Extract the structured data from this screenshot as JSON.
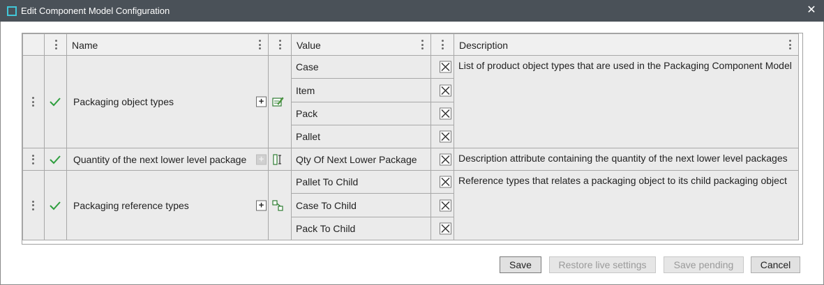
{
  "window": {
    "title": "Edit Component Model Configuration",
    "close_glyph": "✕"
  },
  "columns": {
    "name": "Name",
    "value": "Value",
    "description": "Description"
  },
  "rows": [
    {
      "name": "Packaging object types",
      "status": "check-icon",
      "add_enabled": true,
      "type_icon": "edit-list-icon",
      "values": [
        "Case",
        "Item",
        "Pack",
        "Pallet"
      ],
      "description": "List of product object types that are used in the Packaging Component Model"
    },
    {
      "name": "Quantity of the next lower level package",
      "status": "check-icon",
      "add_enabled": false,
      "type_icon": "attribute-icon",
      "values": [
        "Qty Of Next Lower Package"
      ],
      "description": "Description attribute containing the quantity of the next lower level packages"
    },
    {
      "name": "Packaging reference types",
      "status": "check-icon",
      "add_enabled": true,
      "type_icon": "reference-icon",
      "values": [
        "Pallet To Child",
        "Case To Child",
        "Pack To Child"
      ],
      "description": "Reference types that relates a packaging object to its child packaging object"
    }
  ],
  "buttons": {
    "save": "Save",
    "restore": "Restore live settings",
    "save_pending": "Save pending",
    "cancel": "Cancel"
  },
  "colors": {
    "titlebar": "#4a5158",
    "check": "#2e9e3e",
    "accent": "#41c7d8"
  }
}
